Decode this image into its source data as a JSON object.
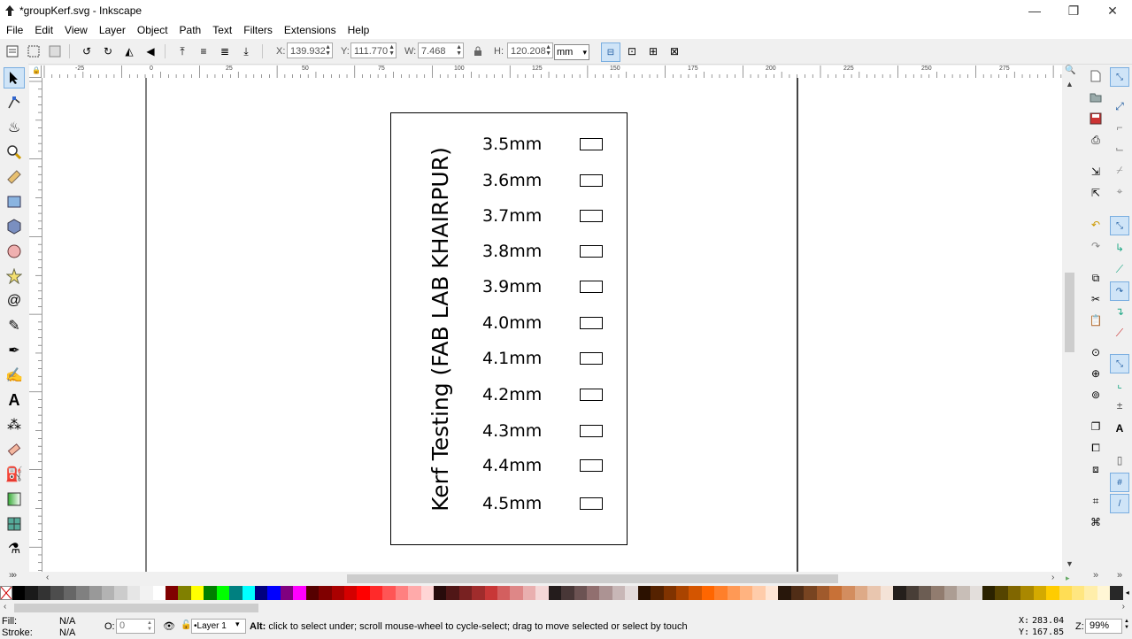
{
  "window": {
    "title": "*groupKerf.svg - Inkscape",
    "min": "—",
    "restore": "❐",
    "close": "✕"
  },
  "menu": [
    "File",
    "Edit",
    "View",
    "Layer",
    "Object",
    "Path",
    "Text",
    "Filters",
    "Extensions",
    "Help"
  ],
  "toolbar": {
    "x_label": "X:",
    "x_value": "139.932",
    "y_label": "Y:",
    "y_value": "111.770",
    "w_label": "W:",
    "w_value": "7.468",
    "h_label": "H:",
    "h_value": "120.208",
    "unit": "mm"
  },
  "ruler": {
    "h_ticks": [
      "-25",
      "0",
      "25",
      "50",
      "75",
      "100",
      "125",
      "150",
      "175",
      "200",
      "225",
      "250",
      "275"
    ],
    "v_ticks": [
      "5",
      "0",
      "2",
      "5",
      "7",
      "5",
      "1",
      "0",
      "1",
      "2",
      "5",
      "1",
      "5",
      "0",
      "1",
      "7",
      "5",
      "2",
      "0",
      "0",
      "2",
      "2",
      "5",
      "2",
      "5",
      "0"
    ]
  },
  "canvas": {
    "title_text": "Kerf Testing (FAB LAB KHAIRPUR)",
    "labels": [
      "3.5mm",
      "3.6mm",
      "3.7mm",
      "3.8mm",
      "3.9mm",
      "4.0mm",
      "4.1mm",
      "4.2mm",
      "4.3mm",
      "4.4mm",
      "4.5mm"
    ]
  },
  "colors": {
    "accent": "#cfe4f7",
    "accent_border": "#7aaee0"
  },
  "palette": [
    "#000000",
    "#1a1a1a",
    "#333333",
    "#4d4d4d",
    "#666666",
    "#808080",
    "#999999",
    "#b3b3b3",
    "#cccccc",
    "#e6e6e6",
    "#f2f2f2",
    "#ffffff",
    "#800000",
    "#808000",
    "#ffff00",
    "#008000",
    "#00ff00",
    "#008080",
    "#00ffff",
    "#000080",
    "#0000ff",
    "#800080",
    "#ff00ff",
    "#550000",
    "#800000",
    "#aa0000",
    "#d40000",
    "#ff0000",
    "#ff2a2a",
    "#ff5555",
    "#ff8080",
    "#ffaaaa",
    "#ffd5d5",
    "#280b0b",
    "#501616",
    "#782121",
    "#a02c2c",
    "#c83737",
    "#d35f5f",
    "#de8787",
    "#e9afaf",
    "#f4d7d7",
    "#241c1c",
    "#483737",
    "#6c5353",
    "#916f6f",
    "#ac9393",
    "#c8b7b7",
    "#e3dbdb",
    "#2b1100",
    "#552200",
    "#803300",
    "#aa4400",
    "#d45500",
    "#ff6600",
    "#ff7f2a",
    "#ff9955",
    "#ffb380",
    "#ffccaa",
    "#ffe6d5",
    "#28170b",
    "#502d16",
    "#784421",
    "#a05a2c",
    "#c87137",
    "#d38d5f",
    "#deaa87",
    "#e9c6af",
    "#f4e3d7",
    "#241f1c",
    "#483e37",
    "#6c5d53",
    "#917c6f",
    "#ac9d93",
    "#c8beb7",
    "#e3dedb",
    "#2b2200",
    "#554400",
    "#806600",
    "#aa8800",
    "#d4aa00",
    "#ffcc00",
    "#ffdd55",
    "#ffe680",
    "#ffeeaa",
    "#fff6d5",
    "#282828"
  ],
  "status": {
    "fill_label": "Fill:",
    "fill_value": "N/A",
    "stroke_label": "Stroke:",
    "stroke_value": "N/A",
    "opacity_label": "O:",
    "opacity_value": "0",
    "layer": "•Layer 1",
    "message_bold": "Alt:",
    "message": " click to select under; scroll mouse-wheel to cycle-select; drag to move selected or select by touch",
    "x_label": "X:",
    "x_value": "283.04",
    "y_label": "Y:",
    "y_value": "167.85",
    "zoom_label": "Z:",
    "zoom_value": "99%"
  }
}
